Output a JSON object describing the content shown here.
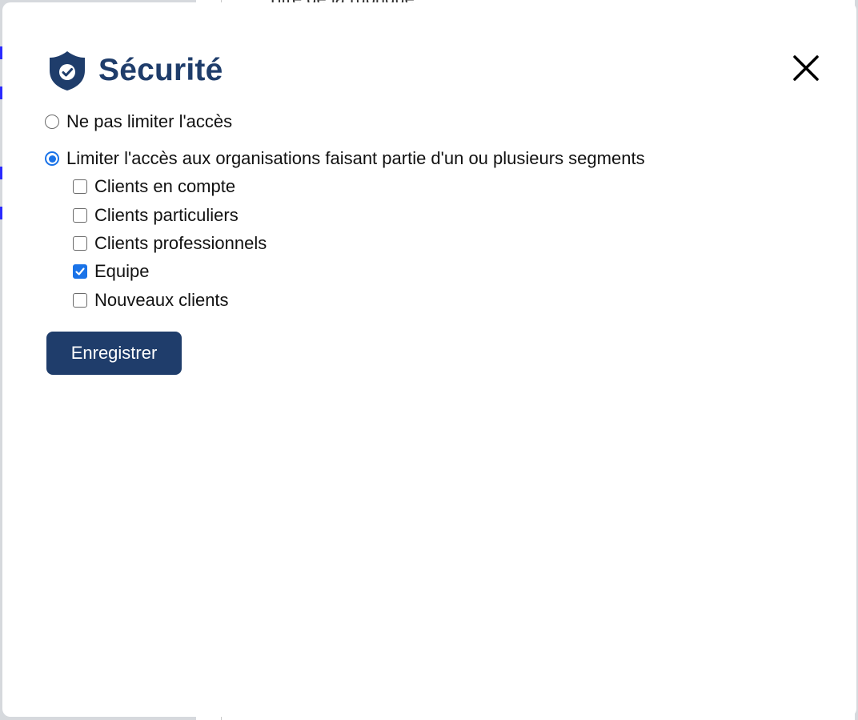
{
  "background": {
    "header_text": "Titre de la rubrique"
  },
  "modal": {
    "title": "Sécurité",
    "title_icon": "shield-check-icon",
    "close_icon": "close-icon",
    "access_options": [
      {
        "label": "Ne pas limiter l'accès",
        "checked": false
      },
      {
        "label": "Limiter l'accès aux organisations faisant partie d'un ou plusieurs segments",
        "checked": true
      }
    ],
    "segments": [
      {
        "label": "Clients en compte",
        "checked": false
      },
      {
        "label": "Clients particuliers",
        "checked": false
      },
      {
        "label": "Clients professionnels",
        "checked": false
      },
      {
        "label": "Equipe",
        "checked": true
      },
      {
        "label": "Nouveaux clients",
        "checked": false
      }
    ],
    "save_label": "Enregistrer"
  },
  "colors": {
    "brand": "#1f3d6b",
    "accent": "#1a73e8"
  }
}
